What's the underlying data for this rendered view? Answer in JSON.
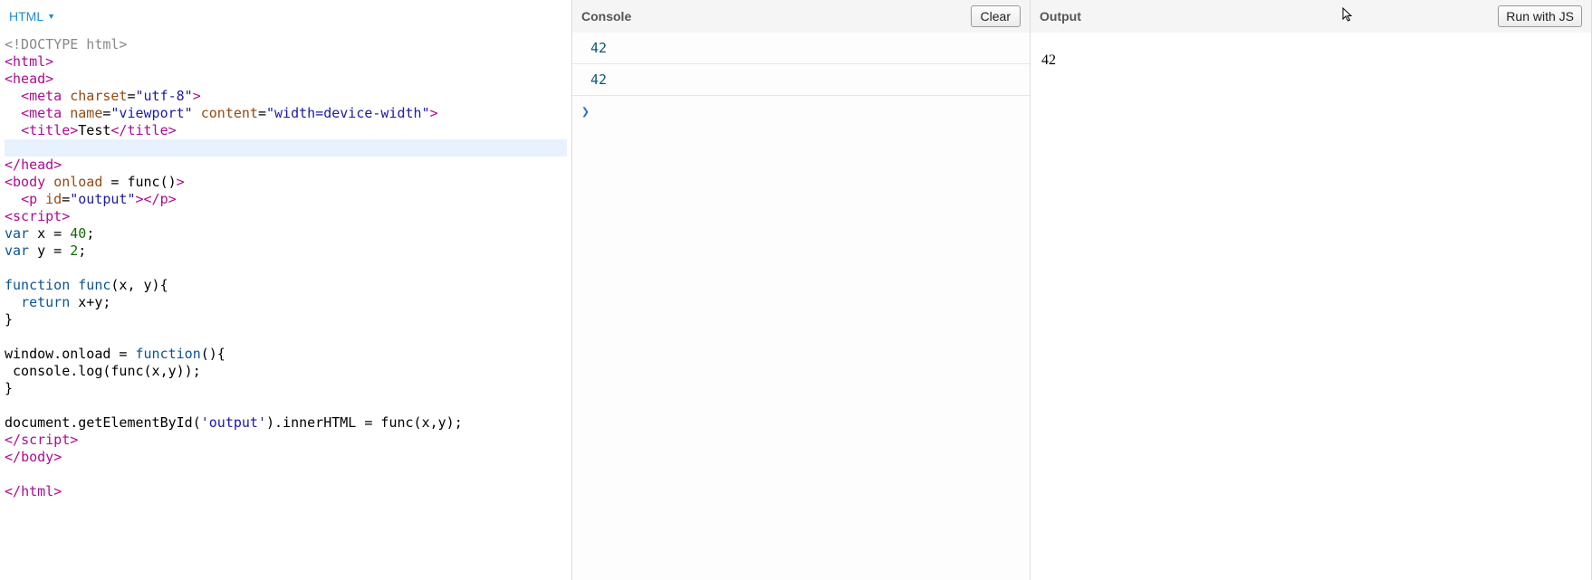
{
  "editor": {
    "language_label": "HTML",
    "code_lines": [
      [
        {
          "cls": "tok-doctype",
          "t": "<!DOCTYPE html>"
        }
      ],
      [
        {
          "cls": "tok-bracket",
          "t": "<"
        },
        {
          "cls": "tok-tag",
          "t": "html"
        },
        {
          "cls": "tok-bracket",
          "t": ">"
        }
      ],
      [
        {
          "cls": "tok-bracket",
          "t": "<"
        },
        {
          "cls": "tok-tag",
          "t": "head"
        },
        {
          "cls": "tok-bracket",
          "t": ">"
        }
      ],
      [
        {
          "cls": "tok-plain",
          "t": "  "
        },
        {
          "cls": "tok-bracket",
          "t": "<"
        },
        {
          "cls": "tok-tag",
          "t": "meta"
        },
        {
          "cls": "tok-plain",
          "t": " "
        },
        {
          "cls": "tok-attr",
          "t": "charset"
        },
        {
          "cls": "tok-plain",
          "t": "="
        },
        {
          "cls": "tok-str",
          "t": "\"utf-8\""
        },
        {
          "cls": "tok-bracket",
          "t": ">"
        }
      ],
      [
        {
          "cls": "tok-plain",
          "t": "  "
        },
        {
          "cls": "tok-bracket",
          "t": "<"
        },
        {
          "cls": "tok-tag",
          "t": "meta"
        },
        {
          "cls": "tok-plain",
          "t": " "
        },
        {
          "cls": "tok-attr",
          "t": "name"
        },
        {
          "cls": "tok-plain",
          "t": "="
        },
        {
          "cls": "tok-str",
          "t": "\"viewport\""
        },
        {
          "cls": "tok-plain",
          "t": " "
        },
        {
          "cls": "tok-attr",
          "t": "content"
        },
        {
          "cls": "tok-plain",
          "t": "="
        },
        {
          "cls": "tok-str",
          "t": "\"width=device-width\""
        },
        {
          "cls": "tok-bracket",
          "t": ">"
        }
      ],
      [
        {
          "cls": "tok-plain",
          "t": "  "
        },
        {
          "cls": "tok-bracket",
          "t": "<"
        },
        {
          "cls": "tok-tag",
          "t": "title"
        },
        {
          "cls": "tok-bracket",
          "t": ">"
        },
        {
          "cls": "tok-plain",
          "t": "Test"
        },
        {
          "cls": "tok-bracket",
          "t": "</"
        },
        {
          "cls": "tok-tag",
          "t": "title"
        },
        {
          "cls": "tok-bracket",
          "t": ">"
        }
      ],
      [],
      [
        {
          "cls": "tok-bracket",
          "t": "</"
        },
        {
          "cls": "tok-tag",
          "t": "head"
        },
        {
          "cls": "tok-bracket",
          "t": ">"
        }
      ],
      [
        {
          "cls": "tok-bracket",
          "t": "<"
        },
        {
          "cls": "tok-tag",
          "t": "body"
        },
        {
          "cls": "tok-plain",
          "t": " "
        },
        {
          "cls": "tok-attr",
          "t": "onload"
        },
        {
          "cls": "tok-plain",
          "t": " = "
        },
        {
          "cls": "tok-plain",
          "t": "func()"
        },
        {
          "cls": "tok-bracket",
          "t": ">"
        }
      ],
      [
        {
          "cls": "tok-plain",
          "t": "  "
        },
        {
          "cls": "tok-bracket",
          "t": "<"
        },
        {
          "cls": "tok-tag",
          "t": "p"
        },
        {
          "cls": "tok-plain",
          "t": " "
        },
        {
          "cls": "tok-attr",
          "t": "id"
        },
        {
          "cls": "tok-plain",
          "t": "="
        },
        {
          "cls": "tok-str",
          "t": "\"output\""
        },
        {
          "cls": "tok-bracket",
          "t": "></"
        },
        {
          "cls": "tok-tag",
          "t": "p"
        },
        {
          "cls": "tok-bracket",
          "t": ">"
        }
      ],
      [
        {
          "cls": "tok-bracket",
          "t": "<"
        },
        {
          "cls": "tok-tag",
          "t": "script"
        },
        {
          "cls": "tok-bracket",
          "t": ">"
        }
      ],
      [
        {
          "cls": "tok-kw",
          "t": "var"
        },
        {
          "cls": "tok-plain",
          "t": " x = "
        },
        {
          "cls": "tok-num",
          "t": "40"
        },
        {
          "cls": "tok-plain",
          "t": ";"
        }
      ],
      [
        {
          "cls": "tok-kw",
          "t": "var"
        },
        {
          "cls": "tok-plain",
          "t": " y = "
        },
        {
          "cls": "tok-num",
          "t": "2"
        },
        {
          "cls": "tok-plain",
          "t": ";"
        }
      ],
      [],
      [
        {
          "cls": "tok-kw",
          "t": "function"
        },
        {
          "cls": "tok-plain",
          "t": " "
        },
        {
          "cls": "tok-fn",
          "t": "func"
        },
        {
          "cls": "tok-plain",
          "t": "(x, y){"
        }
      ],
      [
        {
          "cls": "tok-plain",
          "t": "  "
        },
        {
          "cls": "tok-kw",
          "t": "return"
        },
        {
          "cls": "tok-plain",
          "t": " x+y;"
        }
      ],
      [
        {
          "cls": "tok-plain",
          "t": "}"
        }
      ],
      [],
      [
        {
          "cls": "tok-plain",
          "t": "window.onload = "
        },
        {
          "cls": "tok-kw",
          "t": "function"
        },
        {
          "cls": "tok-plain",
          "t": "(){"
        }
      ],
      [
        {
          "cls": "tok-plain",
          "t": " console.log(func(x,y));"
        }
      ],
      [
        {
          "cls": "tok-plain",
          "t": "}"
        }
      ],
      [],
      [
        {
          "cls": "tok-plain",
          "t": "document.getElementById("
        },
        {
          "cls": "tok-str",
          "t": "'output'"
        },
        {
          "cls": "tok-plain",
          "t": ").innerHTML = func(x,y);"
        }
      ],
      [
        {
          "cls": "tok-bracket",
          "t": "</"
        },
        {
          "cls": "tok-tag",
          "t": "script"
        },
        {
          "cls": "tok-bracket",
          "t": ">"
        }
      ],
      [
        {
          "cls": "tok-bracket",
          "t": "</"
        },
        {
          "cls": "tok-tag",
          "t": "body"
        },
        {
          "cls": "tok-bracket",
          "t": ">"
        }
      ],
      [],
      [
        {
          "cls": "tok-bracket",
          "t": "</"
        },
        {
          "cls": "tok-tag",
          "t": "html"
        },
        {
          "cls": "tok-bracket",
          "t": ">"
        }
      ]
    ],
    "highlighted_line_index": 6
  },
  "console": {
    "title": "Console",
    "clear_label": "Clear",
    "entries": [
      "42",
      "42"
    ],
    "prompt": "❯"
  },
  "output": {
    "title": "Output",
    "run_label": "Run with JS",
    "body": "42"
  }
}
